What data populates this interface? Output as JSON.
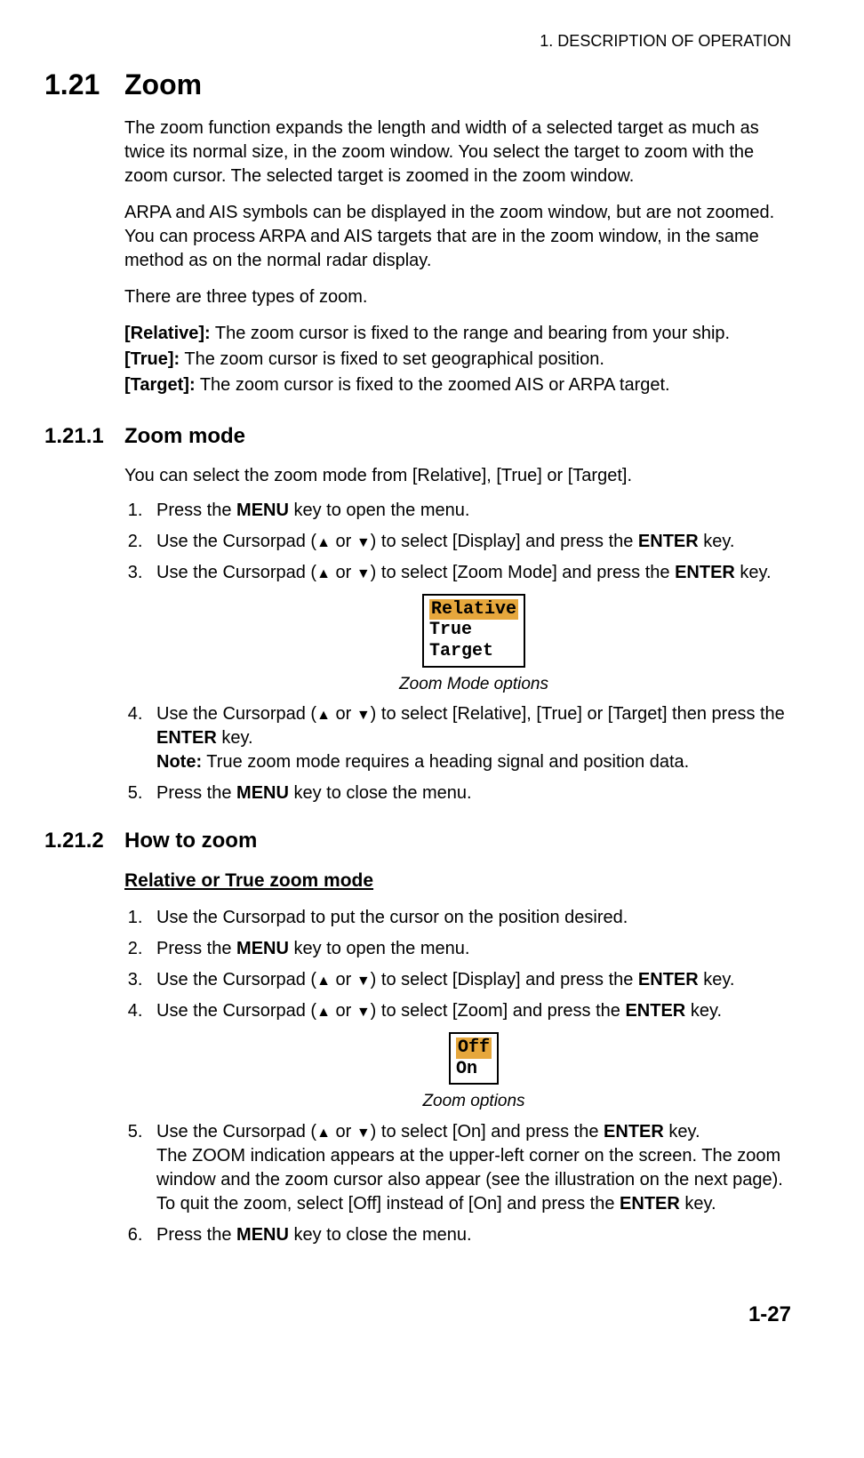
{
  "header": {
    "chapter": "1.  DESCRIPTION OF OPERATION"
  },
  "s1": {
    "num": "1.21",
    "title": "Zoom",
    "p1": "The zoom function expands the length and width of a selected target as much as twice its normal size, in the zoom window. You select the target to zoom with the zoom cursor. The selected target is zoomed in the zoom window.",
    "p2": "ARPA and AIS symbols can be displayed in the zoom window, but are not zoomed. You can process ARPA and AIS targets that are in the zoom window, in the same method as on the normal radar display.",
    "p3": "There are three types of zoom.",
    "d1a": "[Relative]:",
    "d1b": " The zoom cursor is fixed to the range and bearing from your ship.",
    "d2a": "[True]:",
    "d2b": " The zoom cursor is fixed to set geographical position.",
    "d3a": "[Target]:",
    "d3b": " The zoom cursor is fixed to the zoomed AIS or ARPA target."
  },
  "s2": {
    "num": "1.21.1",
    "title": "Zoom mode",
    "intro": "You can select the zoom mode from [Relative], [True] or [Target].",
    "step1a": "Press the ",
    "step1b": "MENU",
    "step1c": " key to open the menu.",
    "step2a": "Use the Cursorpad (",
    "step2b": " or ",
    "step2c": ") to select [Display] and press the ",
    "step2d": "ENTER",
    "step2e": " key.",
    "step3a": "Use the Cursorpad (",
    "step3b": " or ",
    "step3c": ") to select [Zoom Mode] and press the ",
    "step3d": "ENTER",
    "step3e": " key.",
    "fig1_opt1": "Relative",
    "fig1_opt2": "True",
    "fig1_opt3": "Target",
    "fig1_caption": "Zoom Mode options",
    "step4a": "Use the Cursorpad (",
    "step4b": " or ",
    "step4c": ") to select [Relative], [True] or [Target] then press the ",
    "step4d": "ENTER",
    "step4e": " key.",
    "note_label": "Note:",
    "note_text": " True zoom mode requires a heading signal and position data.",
    "step5a": "Press the ",
    "step5b": "MENU",
    "step5c": " key to close the menu."
  },
  "s3": {
    "num": "1.21.2",
    "title": "How to zoom",
    "subheading": "Relative or True zoom mode",
    "step1": "Use the Cursorpad to put the cursor on the position desired.",
    "step2a": "Press the ",
    "step2b": "MENU",
    "step2c": " key to open the menu.",
    "step3a": "Use the Cursorpad (",
    "step3b": " or ",
    "step3c": ") to select [Display] and press the ",
    "step3d": "ENTER",
    "step3e": " key.",
    "step4a": "Use the Cursorpad (",
    "step4b": " or ",
    "step4c": ") to select [Zoom] and press the ",
    "step4d": "ENTER",
    "step4e": " key.",
    "fig2_opt1": "Off",
    "fig2_opt2": "On",
    "fig2_caption": "Zoom options",
    "step5a": "Use the Cursorpad (",
    "step5b": " or ",
    "step5c": ") to select [On] and press the ",
    "step5d": "ENTER",
    "step5e": " key.",
    "step5f": "The ZOOM indication appears at the upper-left corner on the screen. The zoom window and the zoom cursor also appear (see the illustration on the next page). To quit the zoom, select [Off] instead of [On] and press the ",
    "step5g": "ENTER",
    "step5h": " key.",
    "step6a": "Press the ",
    "step6b": "MENU",
    "step6c": " key to close the menu."
  },
  "footer": {
    "page": "1-27"
  },
  "arrows": {
    "up": "▲",
    "down": "▼"
  }
}
